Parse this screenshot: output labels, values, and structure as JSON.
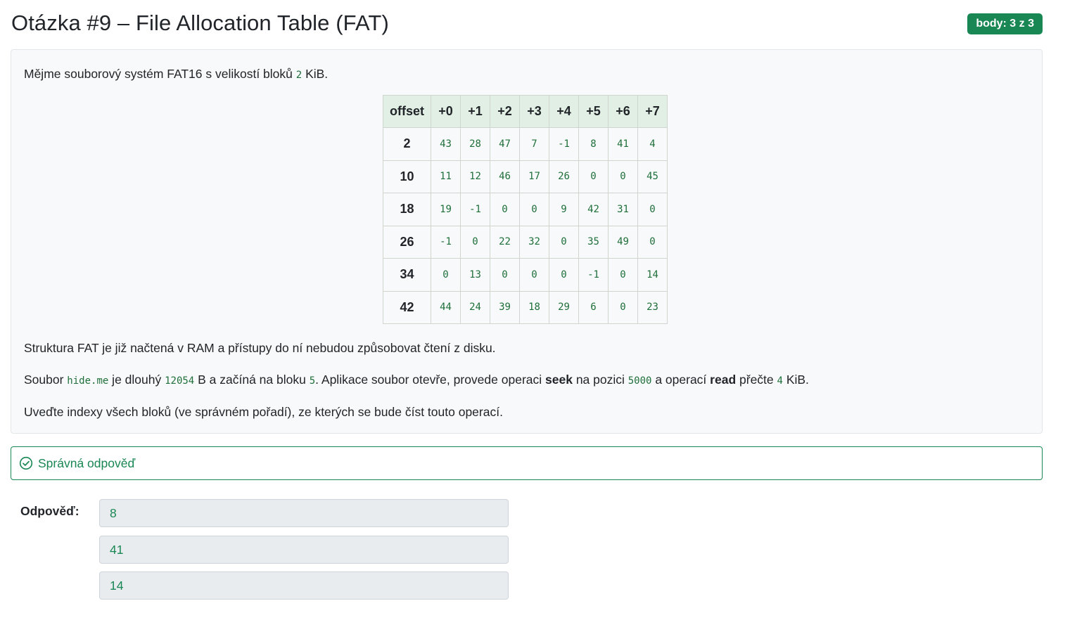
{
  "header": {
    "title": "Otázka #9 – File Allocation Table (FAT)",
    "badge": "body: 3 z 3"
  },
  "question": {
    "intro_before": "Mějme souborový systém FAT16 s velikostí bloků ",
    "block_size": "2",
    "intro_after": " KiB.",
    "fat_note": "Struktura FAT je již načtená v RAM a přístupy do ní nebudou způsobovat čtení z disku.",
    "file": {
      "t1": "Soubor ",
      "name": "hide.me",
      "t2": " je dlouhý ",
      "size": "12054",
      "t3": " B a začíná na bloku ",
      "start": "5",
      "t4": ". Aplikace soubor otevře, provede operaci ",
      "op1": "seek",
      "t5": " na pozici ",
      "pos": "5000",
      "t6": " a operací ",
      "op2": "read",
      "t7": " přečte ",
      "read_size": "4",
      "t8": " KiB."
    },
    "instruction": "Uveďte indexy všech bloků (ve správném pořadí), ze kterých se bude číst touto operací."
  },
  "fat_table": {
    "headers": [
      "offset",
      "+0",
      "+1",
      "+2",
      "+3",
      "+4",
      "+5",
      "+6",
      "+7"
    ],
    "rows": [
      {
        "offset": "2",
        "cells": [
          "43",
          "28",
          "47",
          "7",
          "-1",
          "8",
          "41",
          "4"
        ]
      },
      {
        "offset": "10",
        "cells": [
          "11",
          "12",
          "46",
          "17",
          "26",
          "0",
          "0",
          "45"
        ]
      },
      {
        "offset": "18",
        "cells": [
          "19",
          "-1",
          "0",
          "0",
          "9",
          "42",
          "31",
          "0"
        ]
      },
      {
        "offset": "26",
        "cells": [
          "-1",
          "0",
          "22",
          "32",
          "0",
          "35",
          "49",
          "0"
        ]
      },
      {
        "offset": "34",
        "cells": [
          "0",
          "13",
          "0",
          "0",
          "0",
          "-1",
          "0",
          "14"
        ]
      },
      {
        "offset": "42",
        "cells": [
          "44",
          "24",
          "39",
          "18",
          "29",
          "6",
          "0",
          "23"
        ]
      }
    ]
  },
  "feedback": {
    "text": "Správná odpověď",
    "icon": "check-circle-icon",
    "color": "#198754"
  },
  "answer": {
    "label": "Odpověď:",
    "values": [
      "8",
      "41",
      "14"
    ]
  }
}
